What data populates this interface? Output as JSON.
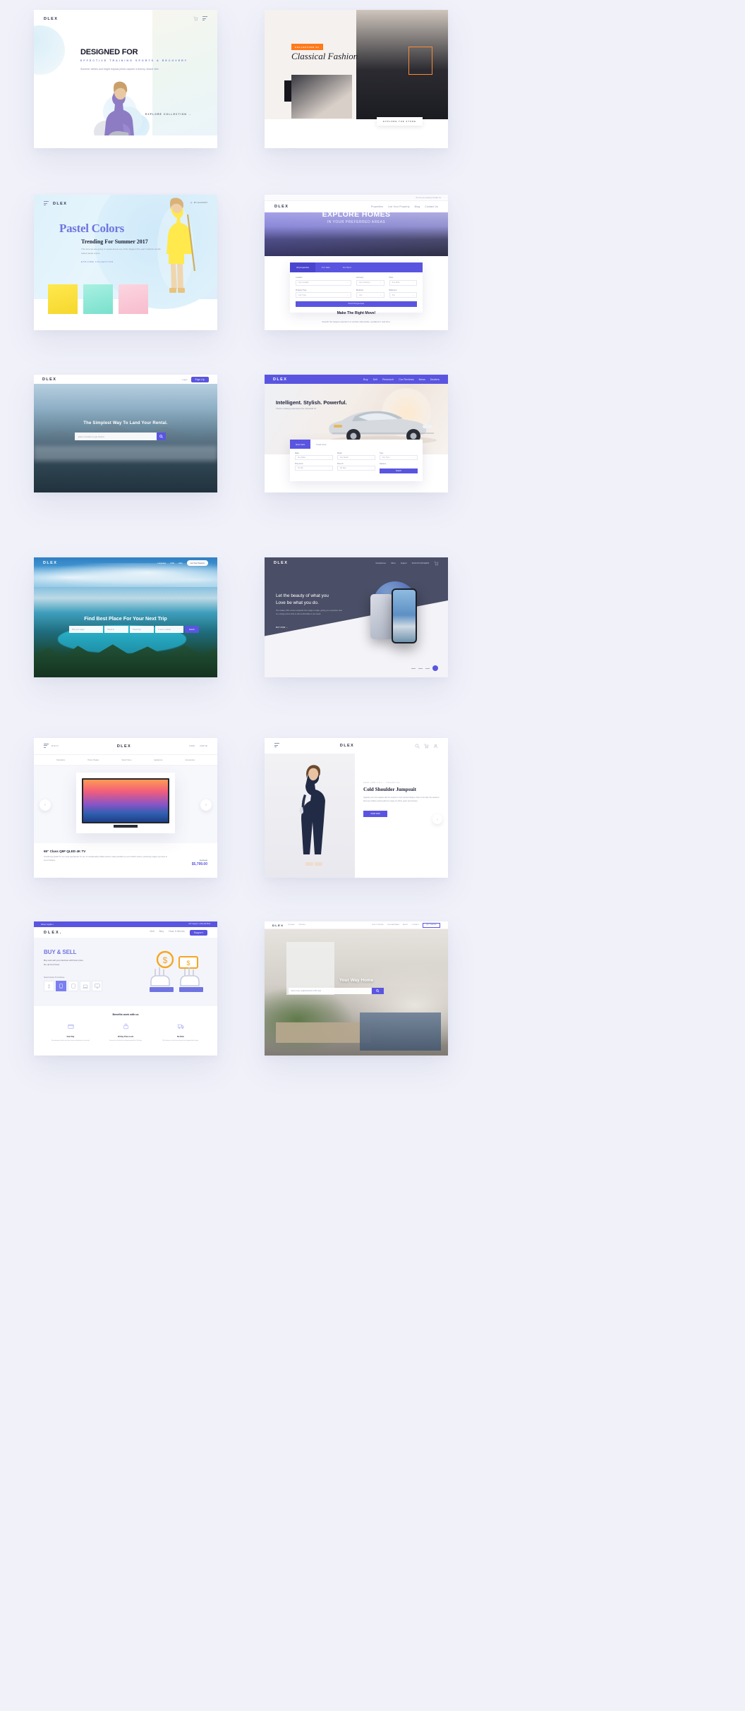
{
  "page": {
    "background": "#f0f1f9",
    "accent": "#5a55e0"
  },
  "cards": [
    {
      "id": "designed-for",
      "brand": "DLEX",
      "title": "DESIGNED FOR",
      "subtitle": "EFFECTIVE TRAINING SPORTS & RECOVERY",
      "body": "Summer whites and bright tropical prints capture a breezy, island vibe.",
      "cta": "EXPLORE COLLECTION  →",
      "icons": [
        "cart-icon",
        "menu-icon"
      ]
    },
    {
      "id": "classical-fashion",
      "badge": "COLLECTION 02",
      "title": "Classical Fashion",
      "cta": "EXPLORE THE STORE"
    },
    {
      "id": "pastel-colors",
      "brand": "DLEX",
      "account": "MY ACCOUNT",
      "title": "Pastel Colors",
      "subtitle": "Trending For Summer 2017",
      "body": "This time we are going to speak about one of the biggest this year's fashion trends called pastel colors.",
      "cta": "EXPLORE COLLECTION"
    },
    {
      "id": "explore-homes",
      "topbar": "To List your property Contact Us",
      "brand": "DLEX",
      "nav": [
        "Properties",
        "List Your Property",
        "Blog",
        "Contact Us"
      ],
      "title": "EXPLORE HOMES",
      "subtitle": "IN YOUR PREFERRED AREAS",
      "tabs": [
        "All properties",
        "For Sale",
        "For Rent"
      ],
      "fields": [
        {
          "label": "Location",
          "value": "Any Location"
        },
        {
          "label": "Currency",
          "value": "Any Currency"
        },
        {
          "label": "Price",
          "value": "Any Price"
        },
        {
          "label": "Property Type",
          "value": "Any Type"
        },
        {
          "label": "Bedroom",
          "value": "Any"
        },
        {
          "label": "Bathroom",
          "value": "Any"
        }
      ],
      "search_button": "Find Properties",
      "footer_title": "Make The Right Move!",
      "footer_body": "Search the largest selection of rentals nationwide, updated in real time."
    },
    {
      "id": "rental-landing",
      "brand": "DLEX",
      "nav": [
        "Login"
      ],
      "signup": "Sign Up",
      "title": "The Simplest Way To Land Your Rental.",
      "search_placeholder": "Enter a location to get started",
      "search_icon": "search-icon"
    },
    {
      "id": "car-dealer",
      "brand": "DLEX",
      "nav": [
        "Buy",
        "Sell",
        "Research",
        "Car Reviews",
        "News",
        "Dealers"
      ],
      "title": "Intelligent. Stylish. Powerful.",
      "subtitle": "There's nothing usual about the JAGUAR XJ",
      "tabs": [
        "New Cars",
        "Used Cars"
      ],
      "fields": [
        {
          "label": "Make",
          "value": "Any Make"
        },
        {
          "label": "Model",
          "value": "Any Model"
        },
        {
          "label": "Type",
          "value": "Any Type"
        },
        {
          "label": "Price From",
          "value": "No Min"
        },
        {
          "label": "Price To",
          "value": "No Max"
        },
        {
          "label": "Distance",
          "value": "Any Distance"
        }
      ],
      "search_button": "Search"
    },
    {
      "id": "travel-trip",
      "brand": "DLEX",
      "nav": [
        "Language",
        "USD",
        "Help"
      ],
      "cta_button": "List Your Property",
      "title": "Find Best Place For Your Next Trip",
      "fields": [
        "Pick your region",
        "Check In",
        "Check Out",
        "1 room, 2 adults"
      ],
      "search_button": "Search"
    },
    {
      "id": "phone-product",
      "brand": "DLEX",
      "nav": [
        "Smartphones",
        "Offers",
        "Support"
      ],
      "shop_link": "SIGN UP FOR NEWS",
      "cart_icon": "cart-icon",
      "title": "Let the beauty of what you\nLove be what you do.",
      "body": "The Galaxy S8's screen expands from edge to edge, giving you a grander view on a larger phone that is still comfortable in one hand.",
      "cta": "BUY NOW  →",
      "pagination": "4 / 4"
    },
    {
      "id": "qled-tv",
      "brand": "DLEX",
      "nav_left": [
        "MENU"
      ],
      "nav_right": [
        "LOGIN",
        "CART (0)"
      ],
      "subnav": [
        "Televisions",
        "Home Theater",
        "Smart Home",
        "Appliances",
        "Accessories"
      ],
      "product_title": "65\" Class Q9F QLED 4K TV",
      "product_body": "Introducing QLED TV, our most spectacular TV yet. An unbelievably brilliant picture made possible by over a billion colors, producing images you have to see to believe.",
      "price_old": "$6,999.99",
      "price": "$5,799.00",
      "arrow_left": "chevron-left-icon",
      "arrow_right": "chevron-right-icon"
    },
    {
      "id": "jumpsuit",
      "brand": "DLEX",
      "menu_icon": "menu-icon",
      "icons": [
        "search-icon",
        "cart-icon",
        "user-icon"
      ],
      "eyebrow": "NEW ARRIVAL / TRENDING",
      "title": "Cold Shoulder Jumpsuit",
      "body": "Upgrade your luxe staples with the season's most coveted designs. Dare to be bold, the season's best new clothes coming with our range of t-shirts, jeans and dresses.",
      "button": "SHOP NOW",
      "arrow_right": "chevron-right-icon"
    },
    {
      "id": "buy-sell",
      "topbar_left": "Market: English ▾",
      "topbar_right": "24/7 Support: 1-333-444-5544",
      "brand": "DLEX.",
      "nav": [
        "Sell",
        "Buy",
        "How It Works",
        "Support"
      ],
      "title": "BUY & SELL",
      "body": "Buy and sell your devices with best price.\nNo up-front fees.",
      "select_label": "Select Device To Continue",
      "devices": [
        "watch-icon",
        "phone-icon",
        "tablet-icon",
        "laptop-icon",
        "desktop-icon"
      ],
      "benefits_title": "Benefits work with us",
      "benefits": [
        {
          "icon": "wallet-icon",
          "title": "Fast Pay",
          "body": "Get payment within one hour of your old phone is received."
        },
        {
          "icon": "lock-icon",
          "title": "30 Day Price Lock",
          "body": "Your price is locked in and guaranteed for 30 days."
        },
        {
          "icon": "truck-icon",
          "title": "No Risk",
          "body": "We ship you a free box and pay for shipping both ways."
        }
      ]
    },
    {
      "id": "your-way-home",
      "brand": "DLEX",
      "nav_left": [
        "HOUSES",
        "PRICING"
      ],
      "nav_right": [
        "HOW IT WORKS",
        "OUR PARTNERS",
        "ABOUT",
        "CONTACT"
      ],
      "cta_button": "GET STARTED",
      "title": "Your Way Home",
      "search_placeholder": "Enter a city, neighbourhood or ZIP code",
      "search_button": "search-icon"
    }
  ]
}
